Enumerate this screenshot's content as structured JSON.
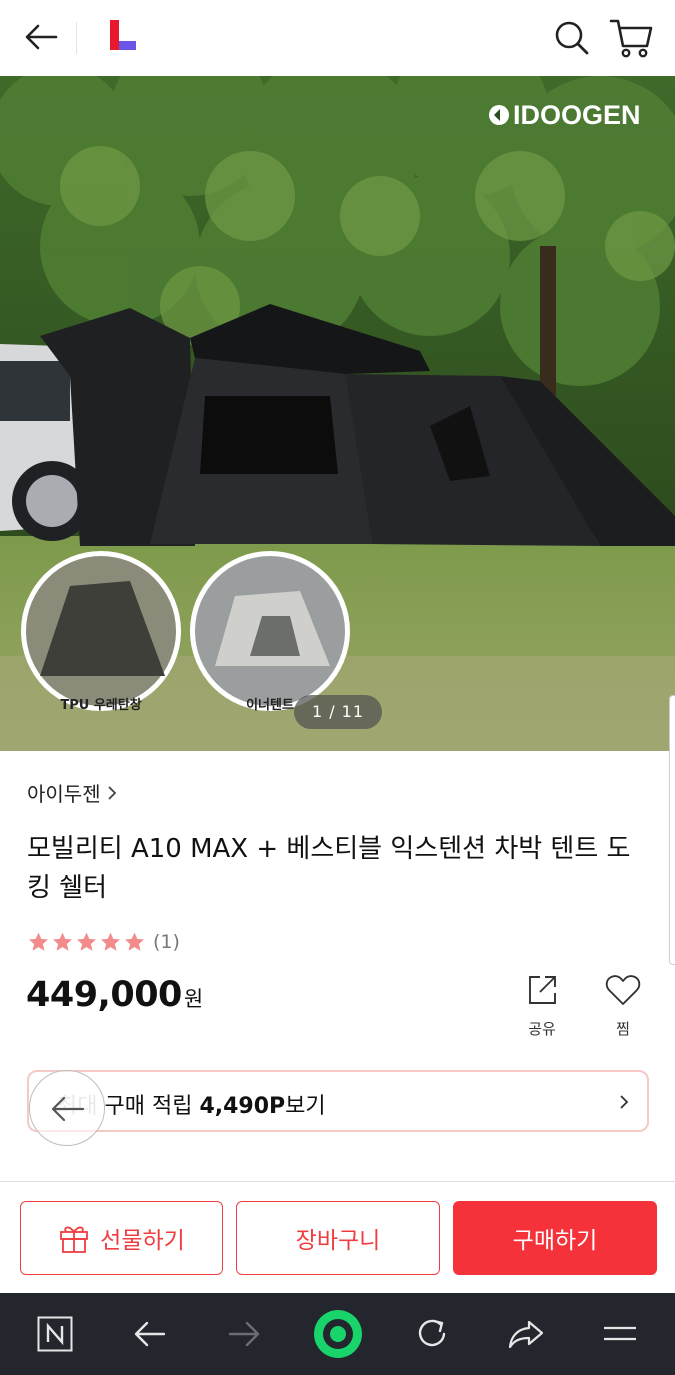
{
  "header": {
    "back_icon": "arrow-left-icon",
    "logo_colors": [
      "#e8192c",
      "#6b55e6"
    ],
    "search_icon": "search-icon",
    "cart_icon": "cart-icon"
  },
  "gallery": {
    "brand_logo_text": "IDOOGEN",
    "thumb_labels": [
      "TPU 우레탄창",
      "이너텐트"
    ],
    "counter": "1 / 11"
  },
  "product": {
    "brand": "아이두젠",
    "title": "모빌리티 A10 MAX + 베스티블 익스텐션 차박 텐트 도킹 쉘터",
    "rating_stars": 5,
    "rating_count": "(1)",
    "price": "449,000",
    "currency": "원"
  },
  "actions": {
    "share_label": "공유",
    "wish_label": "찜"
  },
  "points": {
    "prefix_faded": "최대",
    "text": " 구매 적립 ",
    "amount": "4,490P",
    "suffix": "보기"
  },
  "buttons": {
    "gift": "선물하기",
    "cart": "장바구니",
    "buy": "구매하기"
  },
  "colors": {
    "accent": "#ef3e42",
    "star": "#f28b8b",
    "navbar": "#23272d"
  },
  "browser_nav": {
    "icons": [
      "n-home-icon",
      "back-arrow-icon",
      "forward-arrow-icon",
      "green-dot-icon",
      "reload-icon",
      "share-arrow-icon",
      "menu-icon"
    ]
  }
}
